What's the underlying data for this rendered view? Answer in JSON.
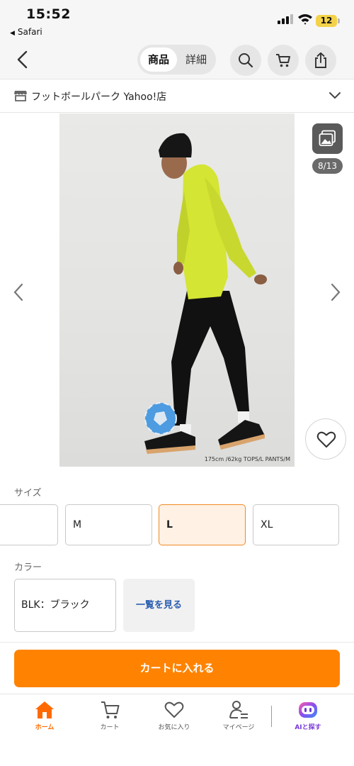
{
  "status_bar": {
    "time": "15:52",
    "back_app": "Safari",
    "battery": "12"
  },
  "nav": {
    "tab_product": "商品",
    "tab_details": "詳細"
  },
  "store": {
    "name": "フットボールパーク Yahoo!店"
  },
  "gallery": {
    "counter": "8/13",
    "caption": "175cm /62kg TOPS/L PANTS/M"
  },
  "options": {
    "size_label": "サイズ",
    "sizes": [
      "",
      "M",
      "L",
      "XL"
    ],
    "selected_size": "L",
    "color_label": "カラー",
    "color_value": "BLK：ブラック",
    "see_all": "一覧を見る"
  },
  "add_to_cart": "カートに入れる",
  "tabbar": {
    "home": "ホーム",
    "cart": "カート",
    "favorites": "お気に入り",
    "mypage": "マイページ",
    "ai": "AIと探す"
  },
  "colors": {
    "accent": "#ff8300",
    "link": "#2a5db0",
    "selected_bg": "#fff1e4",
    "ai": "#7a3ad8"
  }
}
